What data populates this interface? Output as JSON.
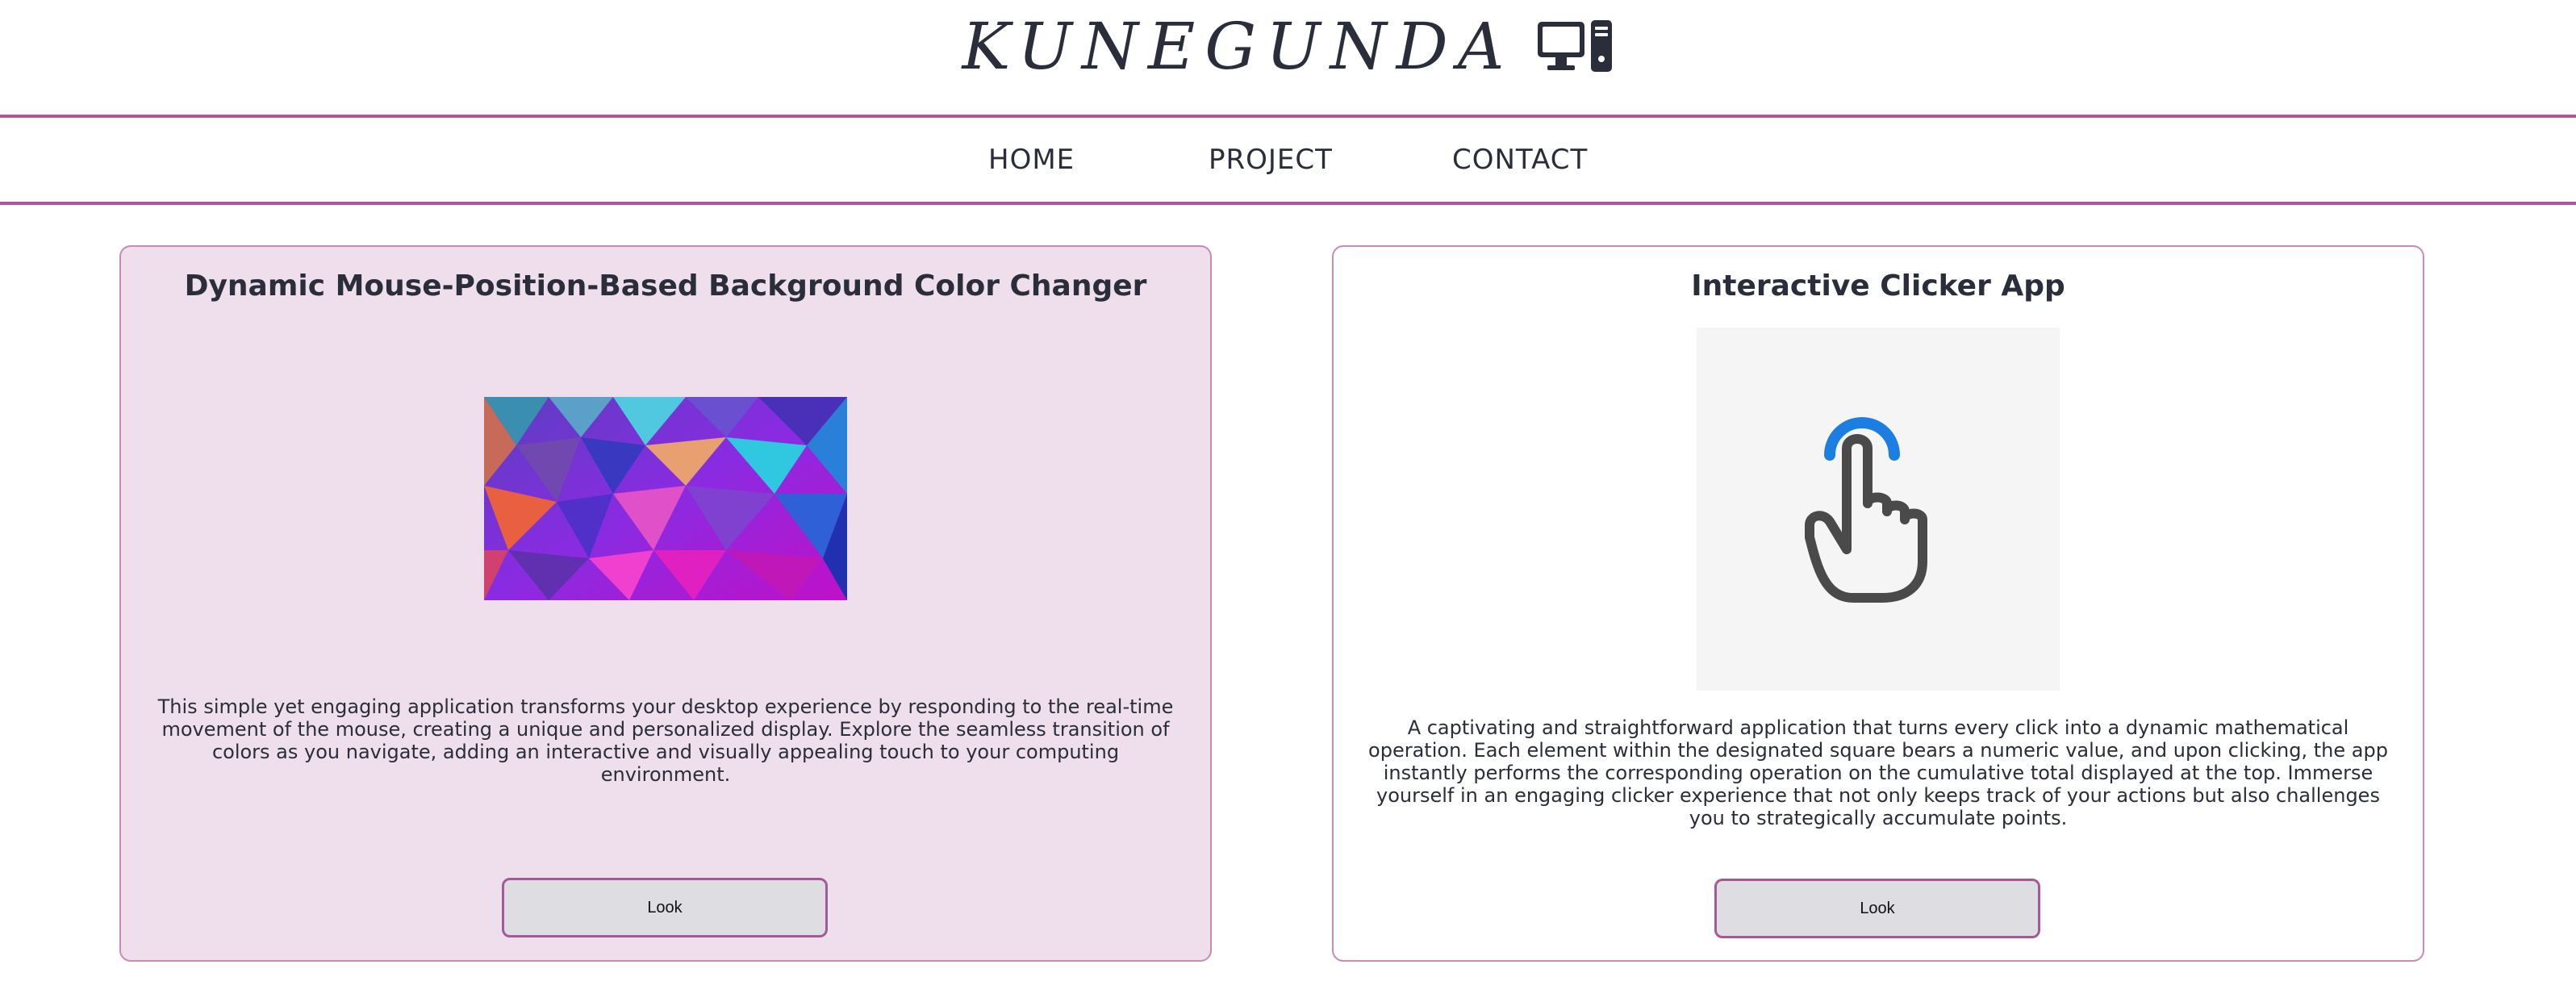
{
  "header": {
    "brand_name": "KUNEGUNDA",
    "brand_icon": "computer-icon"
  },
  "nav": {
    "items": [
      {
        "label": "HOME"
      },
      {
        "label": "PROJECT"
      },
      {
        "label": "CONTACT"
      }
    ]
  },
  "colors": {
    "accent": "#b05596",
    "card_left_bg": "#efdfec",
    "button_bg": "#dedde2",
    "text": "#2a2d3a"
  },
  "projects": [
    {
      "title": "Dynamic Mouse-Position-Based Background Color Changer",
      "image": "polygon-gradient-image",
      "description": "This simple yet engaging application transforms your desktop experience by responding to the real-time movement of the mouse, creating a unique and personalized display. Explore the seamless transition of colors as you navigate, adding an interactive and visually appealing touch to your computing environment.",
      "button_label": "Look"
    },
    {
      "title": "Interactive Clicker App",
      "image": "tap-hand-icon",
      "description": "A captivating and straightforward application that turns every click into a dynamic mathematical operation. Each element within the designated square bears a numeric value, and upon clicking, the app instantly performs the corresponding operation on the cumulative total displayed at the top. Immerse yourself in an engaging clicker experience that not only keeps track of your actions but also challenges you to strategically accumulate points.",
      "button_label": "Look"
    }
  ]
}
